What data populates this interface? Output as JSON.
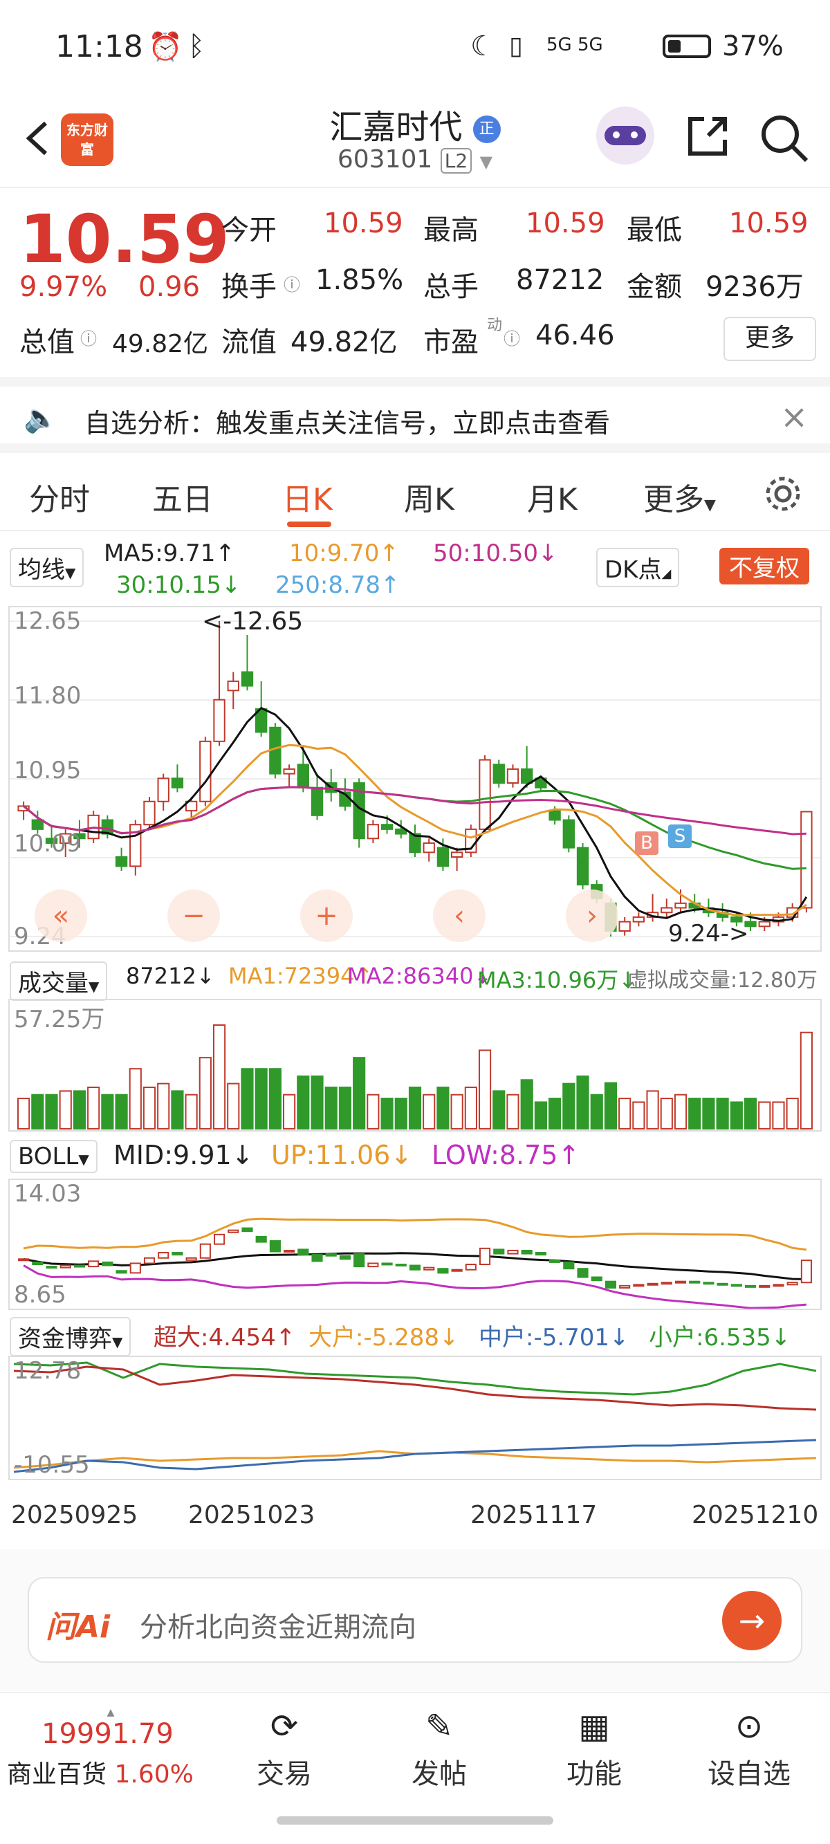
{
  "status_bar": {
    "time": "11:18",
    "indicators": "5G 5G",
    "battery": "37%"
  },
  "header": {
    "logo_text": "东方财富",
    "stock_name": "汇嘉时代",
    "stock_badge": "正",
    "stock_code": "603101",
    "level": "L2"
  },
  "quote": {
    "price": "10.59",
    "change_pct": "9.97%",
    "change": "0.96",
    "open_label": "今开",
    "open": "10.59",
    "high_label": "最高",
    "high": "10.59",
    "low_label": "最低",
    "low": "10.59",
    "turnover_label": "换手",
    "turnover": "1.85%",
    "volume_label": "总手",
    "volume": "87212",
    "amount_label": "金额",
    "amount": "9236万",
    "mktcap_label": "总值",
    "mktcap": "49.82亿",
    "float_label": "流值",
    "float": "49.82亿",
    "pe_label": "市盈",
    "pe_sup": "动",
    "pe": "46.46",
    "more": "更多"
  },
  "alert": {
    "text": "自选分析：触发重点关注信号，立即点击查看"
  },
  "tabs": [
    {
      "label": "分时"
    },
    {
      "label": "五日"
    },
    {
      "label": "日K",
      "active": true
    },
    {
      "label": "周K"
    },
    {
      "label": "月K"
    },
    {
      "label": "更多"
    }
  ],
  "ma_legend": {
    "selector": "均线",
    "ma5": "MA5:9.71↑",
    "ma10": "10:9.70↑",
    "ma50": "50:10.50↓",
    "ma30": "30:10.15↓",
    "ma250": "250:8.78↑",
    "dk": "DK点",
    "adjust": "不复权"
  },
  "kline": {
    "y_labels": [
      "12.65",
      "11.80",
      "10.95",
      "10.09",
      "9.24"
    ],
    "max_note": "<-12.65",
    "min_note": "9.24->",
    "buy_marker": "B",
    "sell_marker": "S"
  },
  "volume_legend": {
    "selector": "成交量",
    "vol": "87212↓",
    "ma1": "MA1:72394↑",
    "ma2": "MA2:86340↓",
    "ma3": "MA3:10.96万↓",
    "virtual": "虚拟成交量:12.80万",
    "y_top": "57.25万"
  },
  "boll_legend": {
    "selector": "BOLL",
    "mid": "MID:9.91↓",
    "up": "UP:11.06↓",
    "low": "LOW:8.75↑",
    "y_top": "14.03",
    "y_bottom": "8.65"
  },
  "fund_legend": {
    "selector": "资金博弈",
    "super": "超大:4.454↑",
    "big": "大户:-5.288↓",
    "mid": "中户:-5.701↓",
    "small": "小户:6.535↓",
    "y_top": "12.78",
    "y_bottom": "-10.55"
  },
  "x_dates": [
    "20250925",
    "20251023",
    "20251117",
    "20251210"
  ],
  "ask_ai": {
    "brand": "问Ai",
    "placeholder": "分析北向资金近期流向"
  },
  "bottom_nav": {
    "index_value": "19991.79",
    "index_name": "商业百货",
    "index_change": "1.60%",
    "items": [
      {
        "label": "交易"
      },
      {
        "label": "发帖"
      },
      {
        "label": "功能"
      },
      {
        "label": "设自选"
      }
    ]
  },
  "colors": {
    "up": "#d7372f",
    "down": "#2f9a2a",
    "accent": "#e8552b"
  },
  "chart_data": {
    "type": "candlestick",
    "ylim": [
      9.24,
      12.65
    ],
    "candles": [
      [
        10.6,
        10.7,
        10.5,
        10.65
      ],
      [
        10.5,
        10.6,
        10.35,
        10.4
      ],
      [
        10.3,
        10.45,
        10.2,
        10.25
      ],
      [
        10.25,
        10.4,
        10.1,
        10.35
      ],
      [
        10.35,
        10.5,
        10.2,
        10.3
      ],
      [
        10.3,
        10.6,
        10.25,
        10.55
      ],
      [
        10.5,
        10.55,
        10.3,
        10.35
      ],
      [
        10.1,
        10.2,
        9.95,
        10.0
      ],
      [
        10.0,
        10.5,
        9.9,
        10.45
      ],
      [
        10.45,
        10.75,
        10.4,
        10.7
      ],
      [
        10.7,
        11.0,
        10.6,
        10.95
      ],
      [
        10.95,
        11.1,
        10.8,
        10.85
      ],
      [
        10.6,
        10.75,
        10.5,
        10.7
      ],
      [
        10.7,
        11.4,
        10.65,
        11.35
      ],
      [
        11.35,
        12.65,
        11.3,
        11.8
      ],
      [
        11.9,
        12.1,
        11.7,
        12.0
      ],
      [
        12.1,
        12.5,
        11.9,
        11.95
      ],
      [
        11.7,
        12.0,
        11.4,
        11.45
      ],
      [
        11.5,
        11.55,
        10.95,
        11.0
      ],
      [
        11.0,
        11.1,
        10.85,
        11.05
      ],
      [
        11.1,
        11.3,
        10.8,
        10.85
      ],
      [
        10.85,
        11.0,
        10.5,
        10.55
      ],
      [
        10.9,
        11.05,
        10.7,
        10.8
      ],
      [
        10.8,
        10.95,
        10.6,
        10.65
      ],
      [
        10.9,
        10.95,
        10.2,
        10.3
      ],
      [
        10.3,
        10.5,
        10.25,
        10.45
      ],
      [
        10.45,
        10.55,
        10.35,
        10.4
      ],
      [
        10.4,
        10.5,
        10.3,
        10.35
      ],
      [
        10.35,
        10.45,
        10.1,
        10.15
      ],
      [
        10.15,
        10.3,
        10.05,
        10.25
      ],
      [
        10.2,
        10.3,
        9.95,
        10.0
      ],
      [
        10.1,
        10.2,
        9.95,
        10.15
      ],
      [
        10.15,
        10.45,
        10.1,
        10.4
      ],
      [
        10.4,
        11.2,
        10.35,
        11.15
      ],
      [
        11.1,
        11.15,
        10.85,
        10.9
      ],
      [
        10.9,
        11.1,
        10.85,
        11.05
      ],
      [
        11.05,
        11.3,
        10.85,
        10.9
      ],
      [
        10.95,
        10.95,
        10.8,
        10.85
      ],
      [
        10.6,
        10.65,
        10.45,
        10.5
      ],
      [
        10.5,
        10.55,
        10.15,
        10.2
      ],
      [
        10.2,
        10.25,
        9.75,
        9.8
      ],
      [
        9.8,
        9.85,
        9.6,
        9.65
      ],
      [
        9.6,
        9.65,
        9.24,
        9.3
      ],
      [
        9.3,
        9.45,
        9.25,
        9.4
      ],
      [
        9.4,
        9.5,
        9.35,
        9.45
      ],
      [
        9.45,
        9.7,
        9.4,
        9.5
      ],
      [
        9.5,
        9.65,
        9.45,
        9.55
      ],
      [
        9.55,
        9.75,
        9.5,
        9.6
      ],
      [
        9.6,
        9.7,
        9.5,
        9.55
      ],
      [
        9.55,
        9.65,
        9.45,
        9.5
      ],
      [
        9.5,
        9.6,
        9.4,
        9.45
      ],
      [
        9.45,
        9.5,
        9.35,
        9.4
      ],
      [
        9.4,
        9.5,
        9.3,
        9.35
      ],
      [
        9.35,
        9.45,
        9.3,
        9.4
      ],
      [
        9.4,
        9.5,
        9.35,
        9.45
      ],
      [
        9.45,
        9.6,
        9.4,
        9.55
      ],
      [
        9.55,
        10.59,
        9.5,
        10.59
      ]
    ]
  }
}
